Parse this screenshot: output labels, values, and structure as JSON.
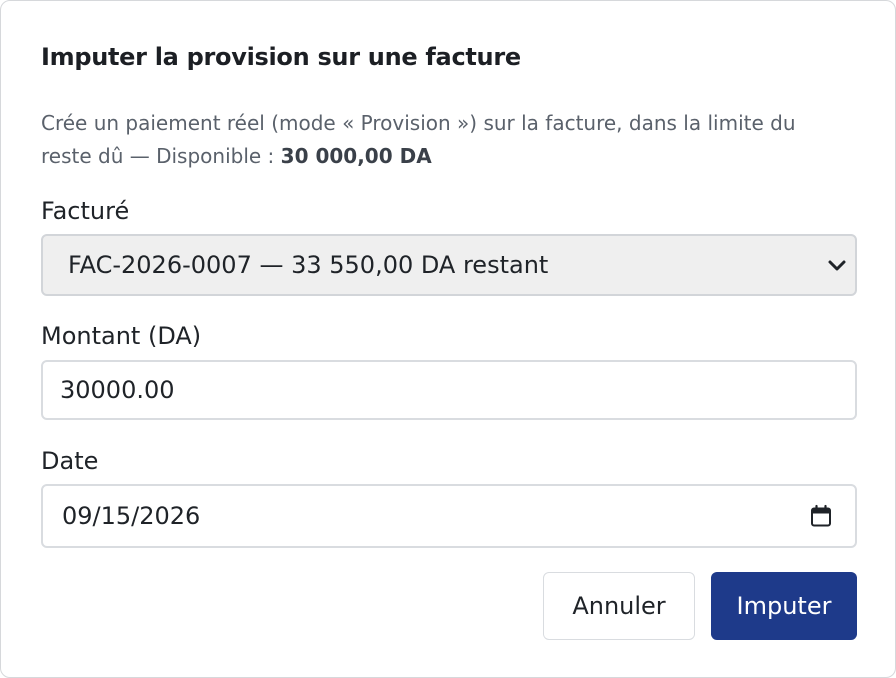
{
  "dialog": {
    "title": "Imputer la provision sur une facture",
    "description_prefix": "Crée un paiement réel (mode « Provision ») sur la facture, dans la limite du reste dû — Disponible : ",
    "available_amount": "30 000,00 DA"
  },
  "form": {
    "invoice_label": "Facturé",
    "invoice_selected": "FAC-2026-0007 — 33 550,00 DA restant",
    "amount_label": "Montant (DA)",
    "amount_value": "30000.00",
    "date_label": "Date",
    "date_value": "09/15/2026"
  },
  "actions": {
    "cancel_label": "Annuler",
    "submit_label": "Imputer"
  },
  "colors": {
    "primary": "#1e3a8a",
    "select_bg": "#efefef",
    "border": "#d9dce0",
    "muted_text": "#5a616b"
  }
}
